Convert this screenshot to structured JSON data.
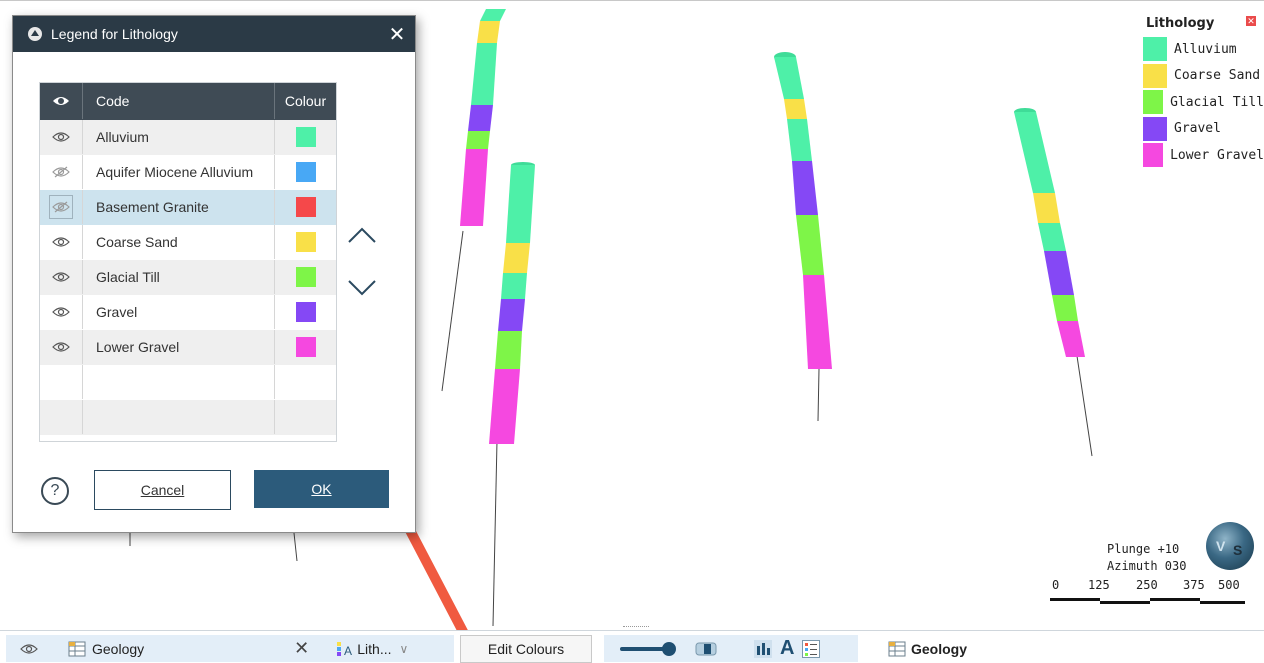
{
  "dialog": {
    "title": "Legend for Lithology",
    "columns": {
      "code": "Code",
      "colour": "Colour"
    },
    "rows": [
      {
        "code": "Alluvium",
        "color": "#4ef0a8",
        "visible": true
      },
      {
        "code": "Aquifer Miocene Alluvium",
        "color": "#48a8f5",
        "visible": false
      },
      {
        "code": "Basement Granite",
        "color": "#f5484a",
        "visible": false,
        "selected": true
      },
      {
        "code": "Coarse Sand",
        "color": "#f9e048",
        "visible": true
      },
      {
        "code": "Glacial Till",
        "color": "#7ef548",
        "visible": true
      },
      {
        "code": "Gravel",
        "color": "#8548f5",
        "visible": true
      },
      {
        "code": "Lower Gravel",
        "color": "#f548e0",
        "visible": true
      }
    ],
    "cancel_label": "Cancel",
    "ok_label": "OK",
    "help_label": "?",
    "close_glyph": "✕"
  },
  "legend": {
    "title": "Lithology",
    "items": [
      {
        "label": "Alluvium",
        "color": "#4ef0a8"
      },
      {
        "label": "Coarse Sand",
        "color": "#f9e048"
      },
      {
        "label": "Glacial Till",
        "color": "#7ef548"
      },
      {
        "label": "Gravel",
        "color": "#8548f5"
      },
      {
        "label": "Lower Gravel",
        "color": "#f548e0"
      }
    ]
  },
  "view": {
    "plunge": "Plunge +10",
    "azimuth": "Azimuth 030",
    "globe_letters": [
      "V",
      "S"
    ],
    "scale_ticks": [
      "0",
      "125",
      "250",
      "375",
      "500"
    ]
  },
  "toolbar": {
    "object_name": "Geology",
    "column_short": "Lith...",
    "edit_colours": "Edit Colours",
    "right_object_name": "Geology",
    "text_icon": "A"
  },
  "colors": {
    "title_bar": "#2b3a46",
    "ok_button": "#2c5b7b",
    "arrow": "#f05a40",
    "header": "#3f4b55"
  }
}
